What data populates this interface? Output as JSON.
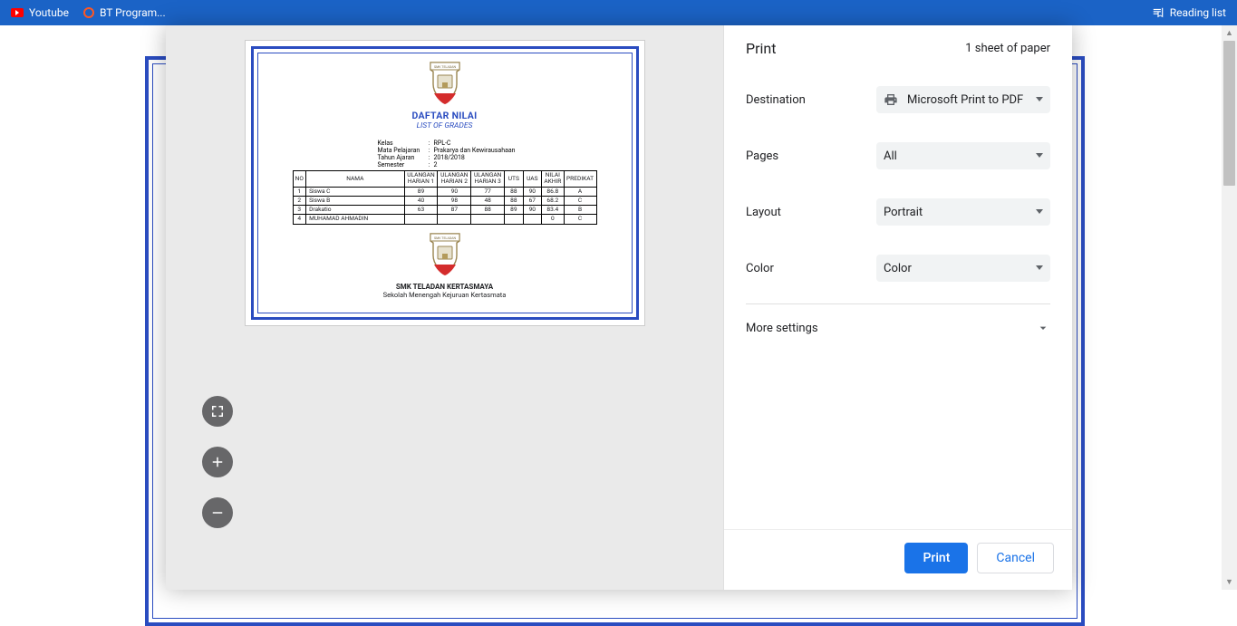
{
  "bookmarks": {
    "youtube": "Youtube",
    "bt": "BT Program...",
    "reading_list": "Reading list"
  },
  "print": {
    "title": "Print",
    "sheets": "1 sheet of paper",
    "labels": {
      "destination": "Destination",
      "pages": "Pages",
      "layout": "Layout",
      "color": "Color",
      "more": "More settings"
    },
    "values": {
      "destination": "Microsoft Print to PDF",
      "pages": "All",
      "layout": "Portrait",
      "color": "Color"
    },
    "buttons": {
      "print": "Print",
      "cancel": "Cancel"
    }
  },
  "doc": {
    "title": "DAFTAR NILAI",
    "subtitle": "LIST OF GRADES",
    "meta": {
      "kelas_l": "Kelas",
      "kelas_v": "RPL-C",
      "mapel_l": "Mata Pelajaran",
      "mapel_v": "Prakarya dan Kewirausahaan",
      "tahun_l": "Tahun Ajaran",
      "tahun_v": "2018/2018",
      "semester_l": "Semester",
      "semester_v": "2"
    },
    "headers": {
      "no": "NO",
      "nama": "NAMA",
      "uh1": "ULANGAN HARIAN 1",
      "uh2": "ULANGAN HARIAN 2",
      "uh3": "ULANGAN HARIAN 3",
      "uts": "UTS",
      "uas": "UAS",
      "akhir": "NILAI AKHIR",
      "pred": "PREDIKAT"
    },
    "rows": [
      {
        "no": "1",
        "nama": "Siswa C",
        "uh1": "89",
        "uh2": "90",
        "uh3": "77",
        "uts": "88",
        "uas": "90",
        "akhir": "86.8",
        "pred": "A"
      },
      {
        "no": "2",
        "nama": "Siswa B",
        "uh1": "40",
        "uh2": "98",
        "uh3": "48",
        "uts": "88",
        "uas": "67",
        "akhir": "68.2",
        "pred": "C"
      },
      {
        "no": "3",
        "nama": "Drakatio",
        "uh1": "63",
        "uh2": "87",
        "uh3": "88",
        "uts": "89",
        "uas": "90",
        "akhir": "83.4",
        "pred": "B"
      },
      {
        "no": "4",
        "nama": "MUHAMAD AHMADIN",
        "uh1": "",
        "uh2": "",
        "uh3": "",
        "uts": "",
        "uas": "",
        "akhir": "0",
        "pred": "C"
      }
    ],
    "school": {
      "name": "SMK TELADAN KERTASMAYA",
      "desc": "Sekolah Menengah Kejuruan Kertasmata"
    },
    "logo_text": "SMK TELADAN"
  }
}
